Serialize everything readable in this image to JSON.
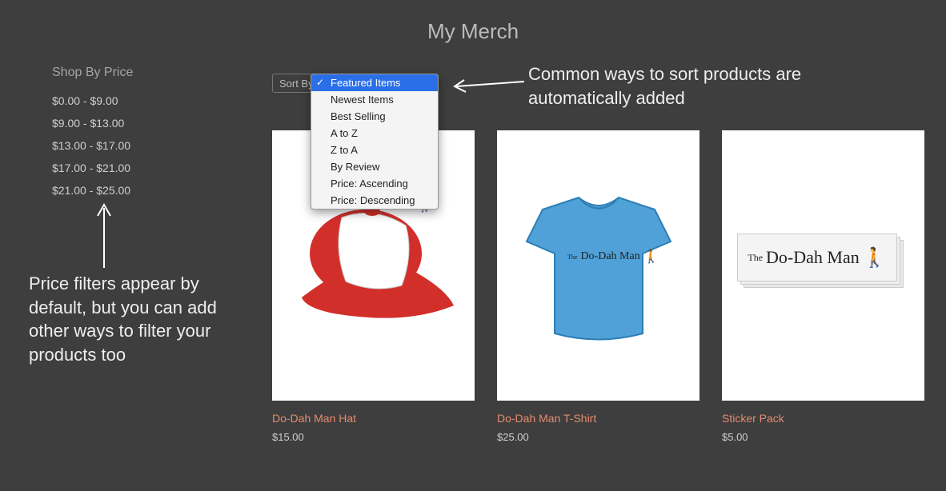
{
  "header": {
    "title": "My Merch"
  },
  "sidebar": {
    "heading": "Shop By Price",
    "ranges": [
      "$0.00 - $9.00",
      "$9.00 - $13.00",
      "$13.00 - $17.00",
      "$17.00 - $21.00",
      "$21.00 - $25.00"
    ]
  },
  "sort": {
    "button_label": "Sort By",
    "selected_index": 0,
    "options": [
      "Featured Items",
      "Newest Items",
      "Best Selling",
      "A to Z",
      "Z to A",
      "By Review",
      "Price: Ascending",
      "Price: Descending"
    ]
  },
  "products": [
    {
      "name": "Do-Dah Man Hat",
      "price": "$15.00",
      "kind": "hat"
    },
    {
      "name": "Do-Dah Man T-Shirt",
      "price": "$25.00",
      "kind": "tshirt"
    },
    {
      "name": "Sticker Pack",
      "price": "$5.00",
      "kind": "sticker"
    }
  ],
  "brand_logo": {
    "the": "The",
    "name": "Do-Dah Man"
  },
  "annotations": {
    "sort_note": "Common ways to sort products are automatically added",
    "filter_note": "Price filters appear by default, but you can add other ways to filter your products too"
  },
  "colors": {
    "link_accent": "#e58a6f",
    "selected_bg": "#2a6fe8",
    "brand_purple": "#5d49c9",
    "hat_red": "#d22f2a",
    "tshirt_blue": "#4fa1d8"
  }
}
